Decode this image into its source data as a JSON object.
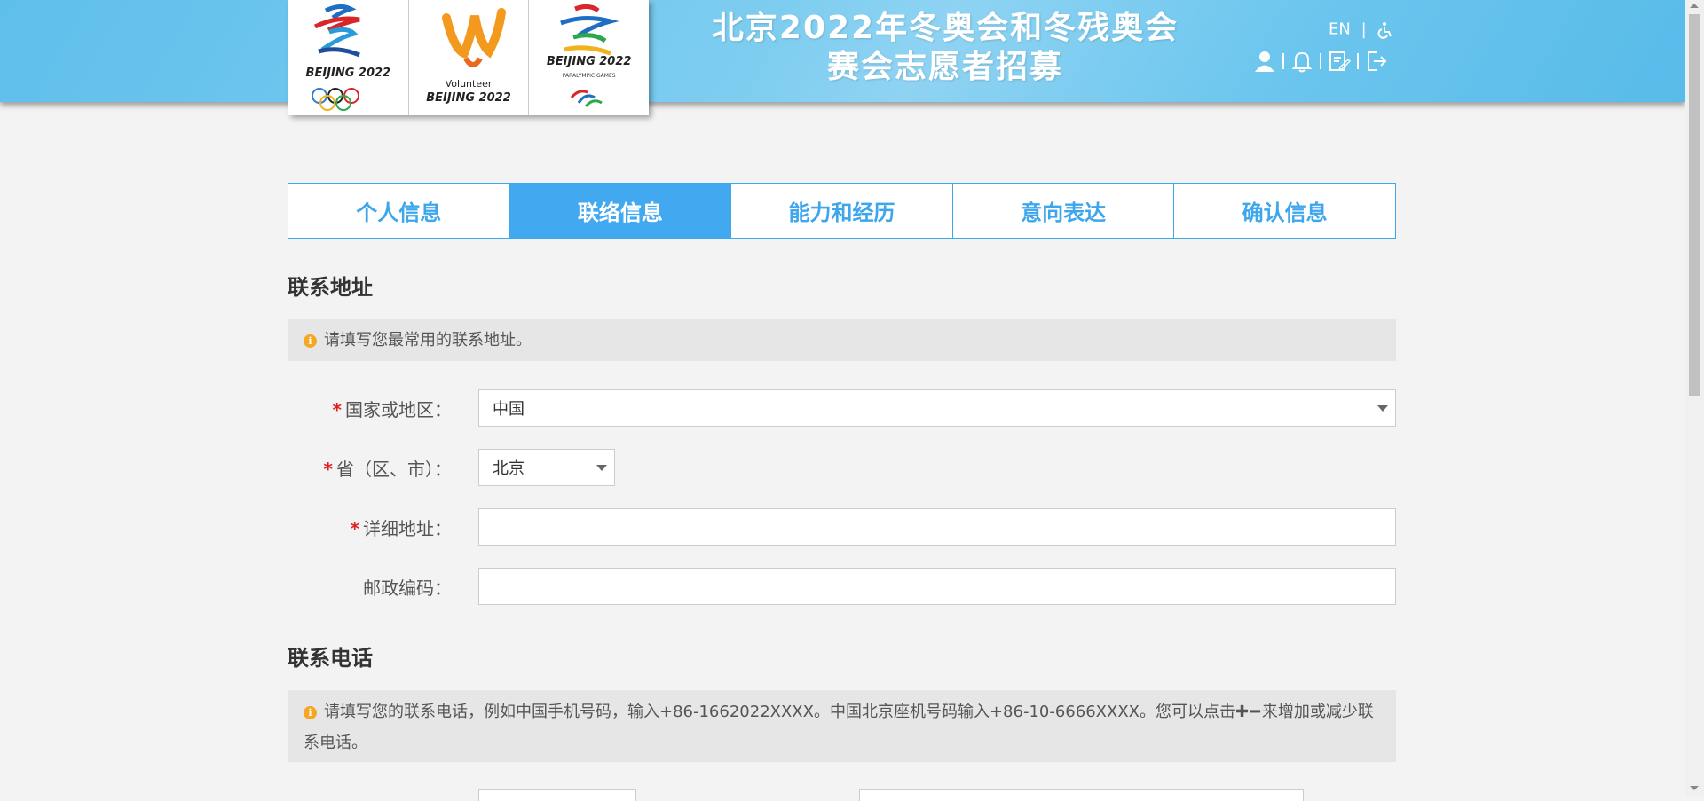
{
  "header": {
    "title_line1": "北京2022年冬奥会和冬残奥会",
    "title_line2": "赛会志愿者招募",
    "lang": "EN",
    "accessibility_icon": "wheelchair-icon",
    "logos": {
      "olympic": "BEIJING 2022",
      "volunteer_small": "Volunteer",
      "volunteer": "BEIJING 2022",
      "paralympic": "BEIJING 2022",
      "paralympic_sub": "PARALYMPIC GAMES"
    },
    "icons": [
      "user-icon",
      "bell-icon",
      "edit-icon",
      "logout-icon"
    ]
  },
  "tabs": [
    "个人信息",
    "联络信息",
    "能力和经历",
    "意向表达",
    "确认信息"
  ],
  "active_tab": 1,
  "address_section": {
    "title": "联系地址",
    "notice": "请填写您最常用的联系地址。",
    "fields": {
      "country_label": "国家或地区：",
      "country_value": "中国",
      "province_label": "省（区、市）：",
      "province_value": "北京",
      "address_label": "详细地址：",
      "address_value": "",
      "postcode_label": "邮政编码：",
      "postcode_value": ""
    }
  },
  "phone_section": {
    "title": "联系电话",
    "notice_part1": "请填写您的联系电话，例如中国手机号码，输入+86-1662022XXXX。中国北京座机号码输入+86-10-6666XXXX。您可以点击",
    "notice_part2": "来增加或减少联系电话。"
  },
  "colors": {
    "accent": "#42a9f0",
    "required": "#e02020",
    "info": "#f5a623"
  }
}
